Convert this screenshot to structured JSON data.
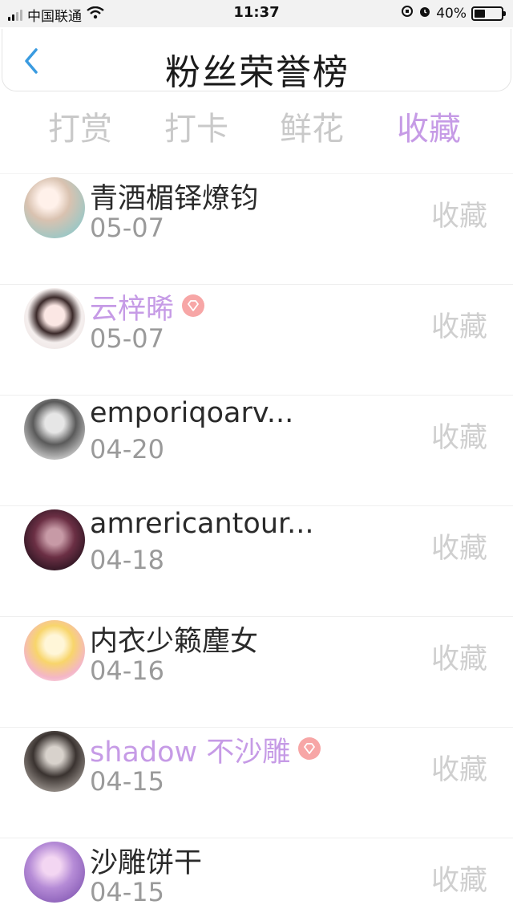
{
  "status": {
    "carrier": "中国联通",
    "time": "11:37",
    "battery": "40%",
    "battery_level": 0.4
  },
  "nav": {
    "title": "粉丝荣誉榜",
    "back_icon": "chevron-left-icon"
  },
  "tabs": [
    {
      "label": "打赏",
      "active": false
    },
    {
      "label": "打卡",
      "active": false
    },
    {
      "label": "鲜花",
      "active": false
    },
    {
      "label": "收藏",
      "active": true
    }
  ],
  "colors": {
    "accent": "#c69be6",
    "badge": "#f7a6a6",
    "inactive": "#c9c9c9"
  },
  "list": [
    {
      "name": "青酒楣铎燎钧",
      "date": "05-07",
      "action": "收藏",
      "vip": false
    },
    {
      "name": "云梓晞",
      "date": "05-07",
      "action": "收藏",
      "vip": true
    },
    {
      "name": "emporiqoarv...",
      "date": "04-20",
      "action": "收藏",
      "vip": false
    },
    {
      "name": "amrericantour...",
      "date": "04-18",
      "action": "收藏",
      "vip": false
    },
    {
      "name": "内衣少籁麈女",
      "date": "04-16",
      "action": "收藏",
      "vip": false
    },
    {
      "name": "shadow 不沙雕",
      "date": "04-15",
      "action": "收藏",
      "vip": true
    },
    {
      "name": "沙雕饼干",
      "date": "04-15",
      "action": "收藏",
      "vip": false
    }
  ]
}
